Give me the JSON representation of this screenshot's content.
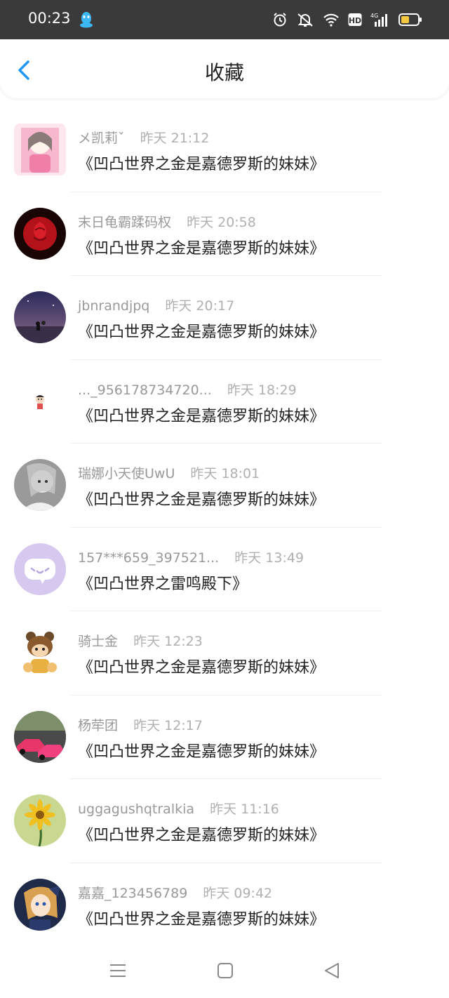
{
  "status_bar": {
    "time": "00:23",
    "icons": [
      "qq-icon",
      "alarm-icon",
      "mute-icon",
      "wifi-icon",
      "hd-icon",
      "signal-4g-icon",
      "battery-icon"
    ],
    "hd_label": "HD",
    "network_label": "4G"
  },
  "header": {
    "title": "收藏",
    "back_icon": "chevron-left-icon",
    "accent_color": "#2196f3"
  },
  "items": [
    {
      "name": "メ凯莉ˇ",
      "time": "昨天 21:12",
      "title": "《凹凸世界之金是嘉德罗斯的妹妹》"
    },
    {
      "name": "末日龟霸蹂码权",
      "time": "昨天 20:58",
      "title": "《凹凸世界之金是嘉德罗斯的妹妹》"
    },
    {
      "name": "jbnrandjpq",
      "time": "昨天 20:17",
      "title": "《凹凸世界之金是嘉德罗斯的妹妹》"
    },
    {
      "name": "..._956178734720...",
      "time": "昨天 18:29",
      "title": "《凹凸世界之金是嘉德罗斯的妹妹》"
    },
    {
      "name": "瑞娜小天使UwU",
      "time": "昨天 18:01",
      "title": "《凹凸世界之金是嘉德罗斯的妹妹》"
    },
    {
      "name": "157***659_397521...",
      "time": "昨天 13:49",
      "title": "《凹凸世界之雷鸣殿下》"
    },
    {
      "name": "骑士金",
      "time": "昨天 12:23",
      "title": "《凹凸世界之金是嘉德罗斯的妹妹》"
    },
    {
      "name": "杨荦团",
      "time": "昨天 12:17",
      "title": "《凹凸世界之金是嘉德罗斯的妹妹》"
    },
    {
      "name": "uggagushqtralkia",
      "time": "昨天 11:16",
      "title": "《凹凸世界之金是嘉德罗斯的妹妹》"
    },
    {
      "name": "嘉嘉_123456789",
      "time": "昨天 09:42",
      "title": "《凹凸世界之金是嘉德罗斯的妹妹》"
    }
  ],
  "nav_bar": {
    "icons": [
      "menu-icon",
      "home-square-icon",
      "back-triangle-icon"
    ]
  }
}
